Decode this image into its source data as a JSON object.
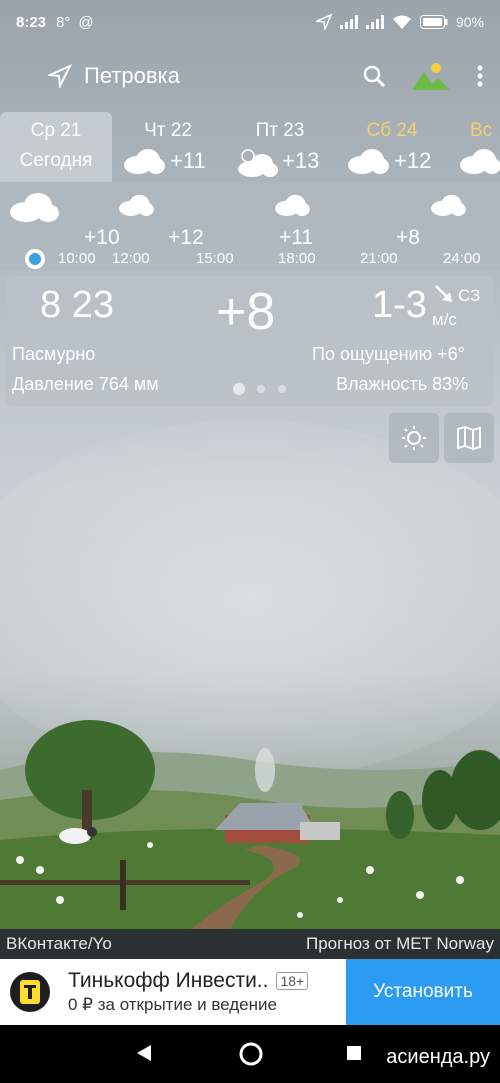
{
  "status_bar": {
    "time": "8:23",
    "extra": "8°",
    "at_symbol": "@",
    "battery": "90%"
  },
  "app_bar": {
    "location": "Петровка",
    "icons": [
      "location-arrow-icon",
      "search-icon",
      "landscape-icon",
      "more-vert-icon"
    ]
  },
  "days": [
    {
      "name": "Ср 21",
      "sub": "Сегодня",
      "temp": "",
      "selected": true
    },
    {
      "name": "Чт 22",
      "temp": "+11",
      "icon": "cloud-icon"
    },
    {
      "name": "Пт 23",
      "temp": "+13",
      "icon": "partly-cloudy-icon"
    },
    {
      "name": "Сб 24",
      "temp": "+12",
      "icon": "cloud-icon",
      "weekend": true
    },
    {
      "name": "Вс",
      "temp": "",
      "icon": "cloud-icon",
      "weekend": true
    }
  ],
  "hourly": {
    "times": [
      "10:00",
      "12:00",
      "15:00",
      "18:00",
      "21:00",
      "24:00"
    ],
    "temps": [
      "+10",
      "+12",
      "+11",
      "+8"
    ]
  },
  "current": {
    "time": "8 23",
    "temp": "+8",
    "wind": "1-3",
    "wind_dir": "СЗ",
    "wind_unit": "м/с",
    "condition": "Пасмурно",
    "feels_like": "По ощущению +6°",
    "pressure": "Давление 764 мм",
    "humidity": "Влажность 83%"
  },
  "credits": {
    "left": "ВКонтакте/Yo",
    "right": "Прогноз от MET Norway"
  },
  "ad": {
    "title": "Тинькофф Инвести..",
    "age": "18+",
    "subtitle": "0 ₽ за открытие и ведение",
    "button": "Установить"
  },
  "watermark": "асиенда.ру",
  "colors": {
    "accent_install": "#2c9cf2",
    "weekend": "#f3d06c",
    "dot_active": "#3aa0e0"
  }
}
